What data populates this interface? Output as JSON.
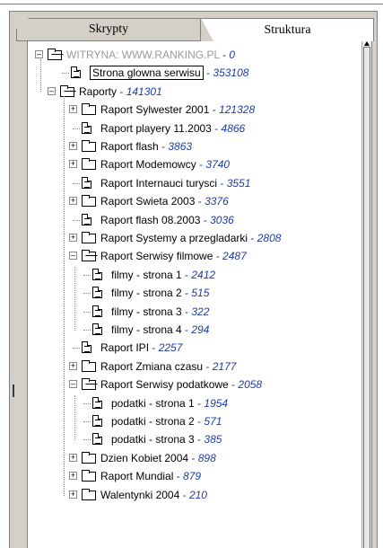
{
  "tabs": {
    "scripts_label": "Skrypty",
    "structure_label": "Struktura",
    "active": "Struktura"
  },
  "tree": {
    "root": {
      "label": "WITRYNA: WWW.RANKING.PL",
      "count": "0",
      "icon": "site-folder-open-icon"
    },
    "home": {
      "label": "Strona glowna serwisu",
      "count": "353108",
      "icon": "document-icon"
    },
    "reports": {
      "label": "Raporty",
      "count": "141301",
      "icon": "folder-open-icon"
    },
    "items": [
      {
        "label": "Raport Sylwester 2001",
        "count": "121328",
        "icon": "folder-icon",
        "expander": "+"
      },
      {
        "label": "Raport playery 11.2003",
        "count": "4866",
        "icon": "document-icon"
      },
      {
        "label": "Raport flash",
        "count": "3863",
        "icon": "folder-icon",
        "expander": "+"
      },
      {
        "label": "Raport Modemowcy",
        "count": "3740",
        "icon": "folder-icon",
        "expander": "+"
      },
      {
        "label": "Raport Internauci turysci",
        "count": "3551",
        "icon": "document-icon"
      },
      {
        "label": "Raport Swieta 2003",
        "count": "3376",
        "icon": "folder-icon",
        "expander": "+"
      },
      {
        "label": "Raport flash 08.2003",
        "count": "3036",
        "icon": "document-icon"
      },
      {
        "label": "Raport Systemy a przegladarki",
        "count": "2808",
        "icon": "folder-icon",
        "expander": "+"
      },
      {
        "label": "Raport Serwisy filmowe",
        "count": "2487",
        "icon": "folder-open-icon",
        "expander": "-"
      },
      {
        "label": "filmy - strona 1",
        "count": "2412",
        "icon": "document-icon",
        "child": true
      },
      {
        "label": "filmy - strona 2",
        "count": "515",
        "icon": "document-icon",
        "child": true
      },
      {
        "label": "filmy - strona 3",
        "count": "322",
        "icon": "document-icon",
        "child": true
      },
      {
        "label": "filmy - strona 4",
        "count": "294",
        "icon": "document-icon",
        "child": true
      },
      {
        "label": "Raport IPI",
        "count": "2257",
        "icon": "document-icon"
      },
      {
        "label": "Raport Zmiana czasu",
        "count": "2177",
        "icon": "folder-icon",
        "expander": "+"
      },
      {
        "label": "Raport Serwisy podatkowe",
        "count": "2058",
        "icon": "folder-open-icon",
        "expander": "-"
      },
      {
        "label": "podatki - strona 1",
        "count": "1954",
        "icon": "document-icon",
        "child": true
      },
      {
        "label": "podatki - strona 2",
        "count": "571",
        "icon": "document-icon",
        "child": true
      },
      {
        "label": "podatki - strona 3",
        "count": "385",
        "icon": "document-icon",
        "child": true
      },
      {
        "label": "Dzien Kobiet 2004",
        "count": "898",
        "icon": "folder-icon",
        "expander": "+"
      },
      {
        "label": "Raport Mundial",
        "count": "879",
        "icon": "folder-icon",
        "expander": "+"
      },
      {
        "label": "Walentynki 2004",
        "count": "210",
        "icon": "folder-icon",
        "expander": "+"
      }
    ]
  },
  "colors": {
    "count_text": "#1e3aa8",
    "root_text": "#9a9a9a",
    "frame": "#d4d0c8"
  }
}
